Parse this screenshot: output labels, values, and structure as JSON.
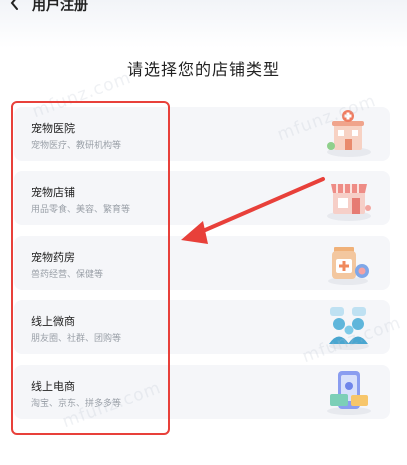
{
  "header": {
    "title": "用户注册",
    "back_icon": "chevron-left-icon"
  },
  "main": {
    "title": "请选择您的店铺类型",
    "cards": [
      {
        "label": "宠物医院",
        "desc": "宠物医疗、教研机构等",
        "icon": "pet-hospital-icon"
      },
      {
        "label": "宠物店铺",
        "desc": "用品零食、美容、繁育等",
        "icon": "pet-shop-icon"
      },
      {
        "label": "宠物药房",
        "desc": "兽药经营、保健等",
        "icon": "pet-pharmacy-icon"
      },
      {
        "label": "线上微商",
        "desc": "朋友圈、社群、团购等",
        "icon": "wechat-business-icon"
      },
      {
        "label": "线上电商",
        "desc": "淘宝、京东、拼多多等",
        "icon": "ecommerce-icon"
      }
    ]
  },
  "annotation": {
    "color": "#e8403a"
  },
  "watermark": {
    "text": "mfunz.com"
  }
}
